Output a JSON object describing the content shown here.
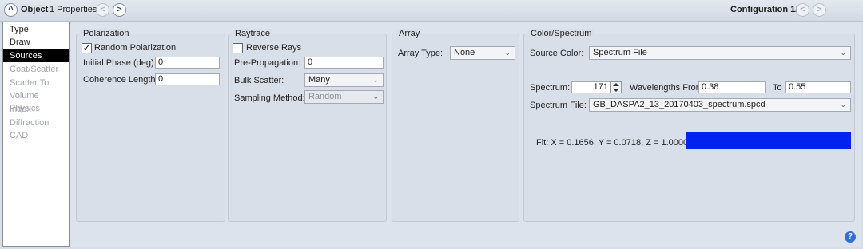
{
  "titlebar": {
    "collapse_glyph": "^",
    "title": "Object",
    "properties": "1 Properties",
    "prev_glyph": "<",
    "next_glyph": ">",
    "configuration": "Configuration 1/1"
  },
  "sidebar": {
    "items": [
      {
        "label": "Type",
        "state": "normal"
      },
      {
        "label": "Draw",
        "state": "normal"
      },
      {
        "label": "Sources",
        "state": "selected"
      },
      {
        "label": "Coat/Scatter",
        "state": "disabled"
      },
      {
        "label": "Scatter To",
        "state": "disabled"
      },
      {
        "label": "Volume Physics",
        "state": "disabled"
      },
      {
        "label": "Index",
        "state": "disabled"
      },
      {
        "label": "Diffraction",
        "state": "disabled"
      },
      {
        "label": "CAD",
        "state": "disabled"
      }
    ]
  },
  "polarization": {
    "title": "Polarization",
    "random_label": "Random Polarization",
    "random_checked": true,
    "initial_phase_label": "Initial Phase (deg):",
    "initial_phase_value": "0",
    "coherence_label": "Coherence Length:",
    "coherence_value": "0"
  },
  "raytrace": {
    "title": "Raytrace",
    "reverse_label": "Reverse Rays",
    "reverse_checked": false,
    "pre_propagation_label": "Pre-Propagation:",
    "pre_propagation_value": "0",
    "bulk_scatter_label": "Bulk Scatter:",
    "bulk_scatter_value": "Many",
    "sampling_label": "Sampling Method:",
    "sampling_value": "Random"
  },
  "array": {
    "title": "Array",
    "type_label": "Array Type:",
    "type_value": "None"
  },
  "color_spectrum": {
    "title": "Color/Spectrum",
    "source_color_label": "Source Color:",
    "source_color_value": "Spectrum File",
    "spectrum_label": "Spectrum:",
    "spectrum_value": "171",
    "wavelengths_from_label": "Wavelengths From",
    "wavelengths_from_value": "0.38",
    "to_label": "To",
    "to_value": "0.55",
    "spectrum_file_label": "Spectrum File:",
    "spectrum_file_value": "GB_DASPA2_13_20170403_spectrum.spcd",
    "fit_text": "Fit: X = 0.1656, Y = 0.0718, Z = 1.0000",
    "swatch_color": "#0022ee"
  },
  "chevron_glyph": "⌄",
  "help_glyph": "?"
}
